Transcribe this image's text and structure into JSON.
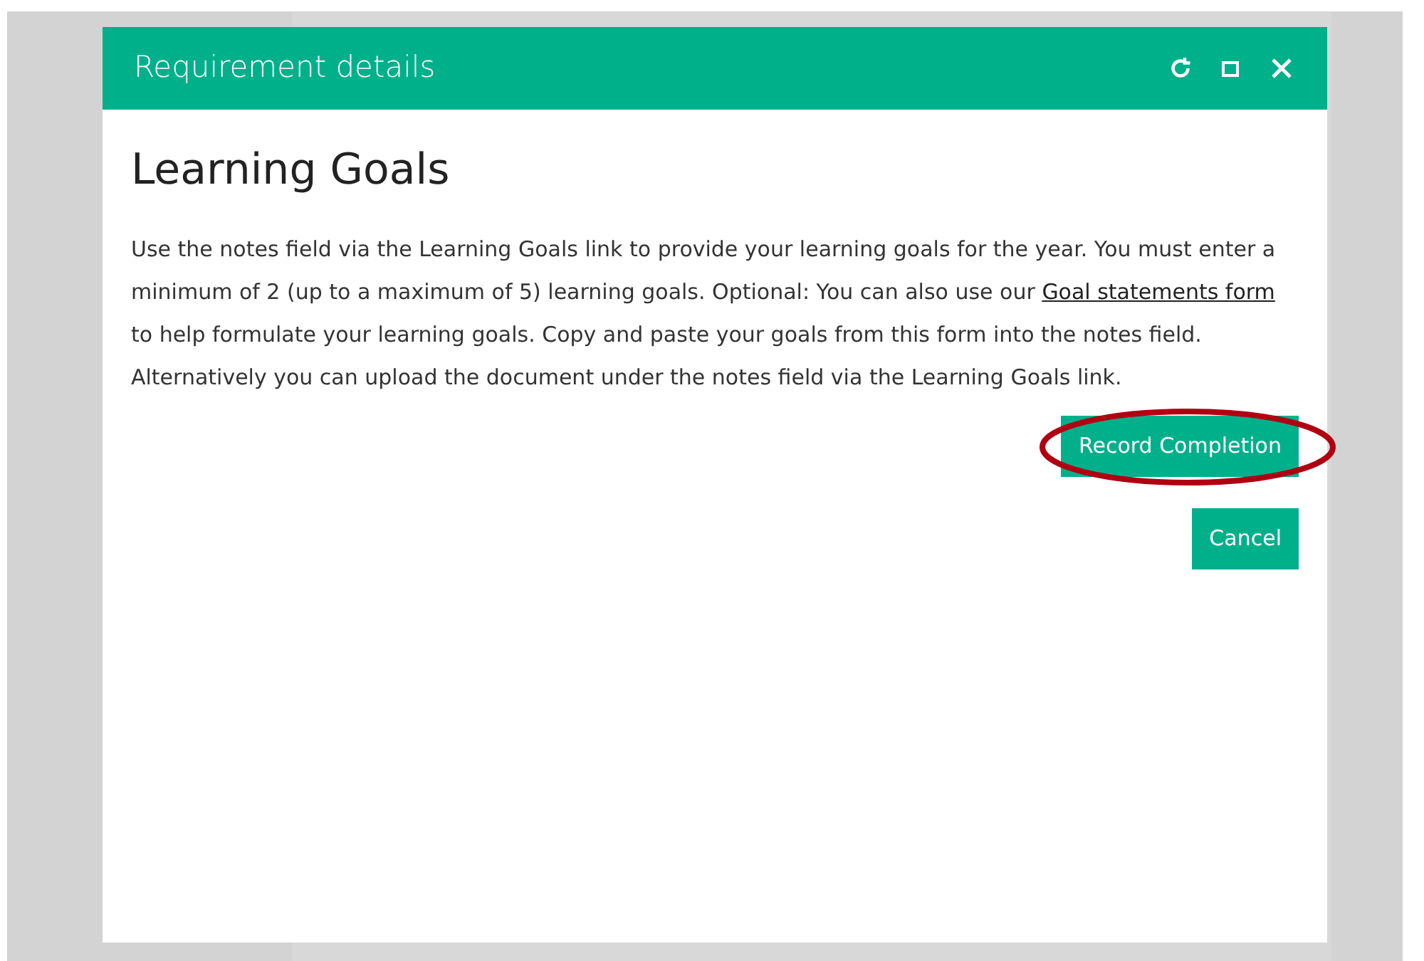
{
  "dialog": {
    "title": "Requirement details",
    "heading": "Learning Goals",
    "body": {
      "before": "Use the notes field via the Learning Goals link to provide your learning goals for the year. You must enter a minimum of 2 (up to a maximum of 5) learning goals. Optional: You can also use our",
      "link": "Goal statements form",
      "after": "to help formulate your learning goals. Copy and paste your goals from this form into the notes field. Alternatively you can upload the document under the notes field via the Learning Goals link."
    },
    "buttons": [
      {
        "label": "Record Completion",
        "highlighted": true
      },
      {
        "label": "Cancel",
        "highlighted": false
      }
    ]
  }
}
